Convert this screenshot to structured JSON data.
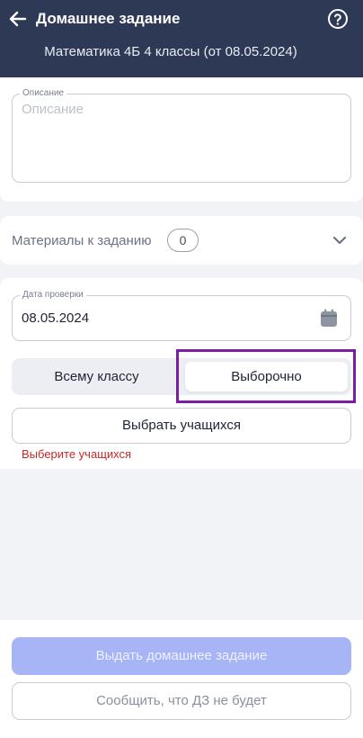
{
  "header": {
    "title": "Домашнее задание",
    "subtitle": "Математика 4Б 4 классы (от 08.05.2024)",
    "back_icon": "arrow-left-icon",
    "help_icon": "question-circle-icon"
  },
  "description": {
    "label": "Описание",
    "placeholder": "Описание",
    "value": ""
  },
  "materials": {
    "label": "Материалы к заданию",
    "count": "0",
    "expand_icon": "chevron-down-icon"
  },
  "check_date": {
    "label": "Дата проверки",
    "value": "08.05.2024",
    "icon": "calendar-icon"
  },
  "assign_to": {
    "options": [
      "Всему классу",
      "Выборочно"
    ],
    "selected": "Выборочно"
  },
  "students": {
    "button_label": "Выбрать учащихся",
    "error": "Выберите учащихся"
  },
  "footer": {
    "primary_label": "Выдать домашнее задание",
    "secondary_label": "Сообщить, что ДЗ не будет"
  },
  "colors": {
    "header_bg": "#2e3956",
    "primary_disabled": "#a7b4f5",
    "error": "#c62828",
    "highlight": "#7b1fa2"
  }
}
